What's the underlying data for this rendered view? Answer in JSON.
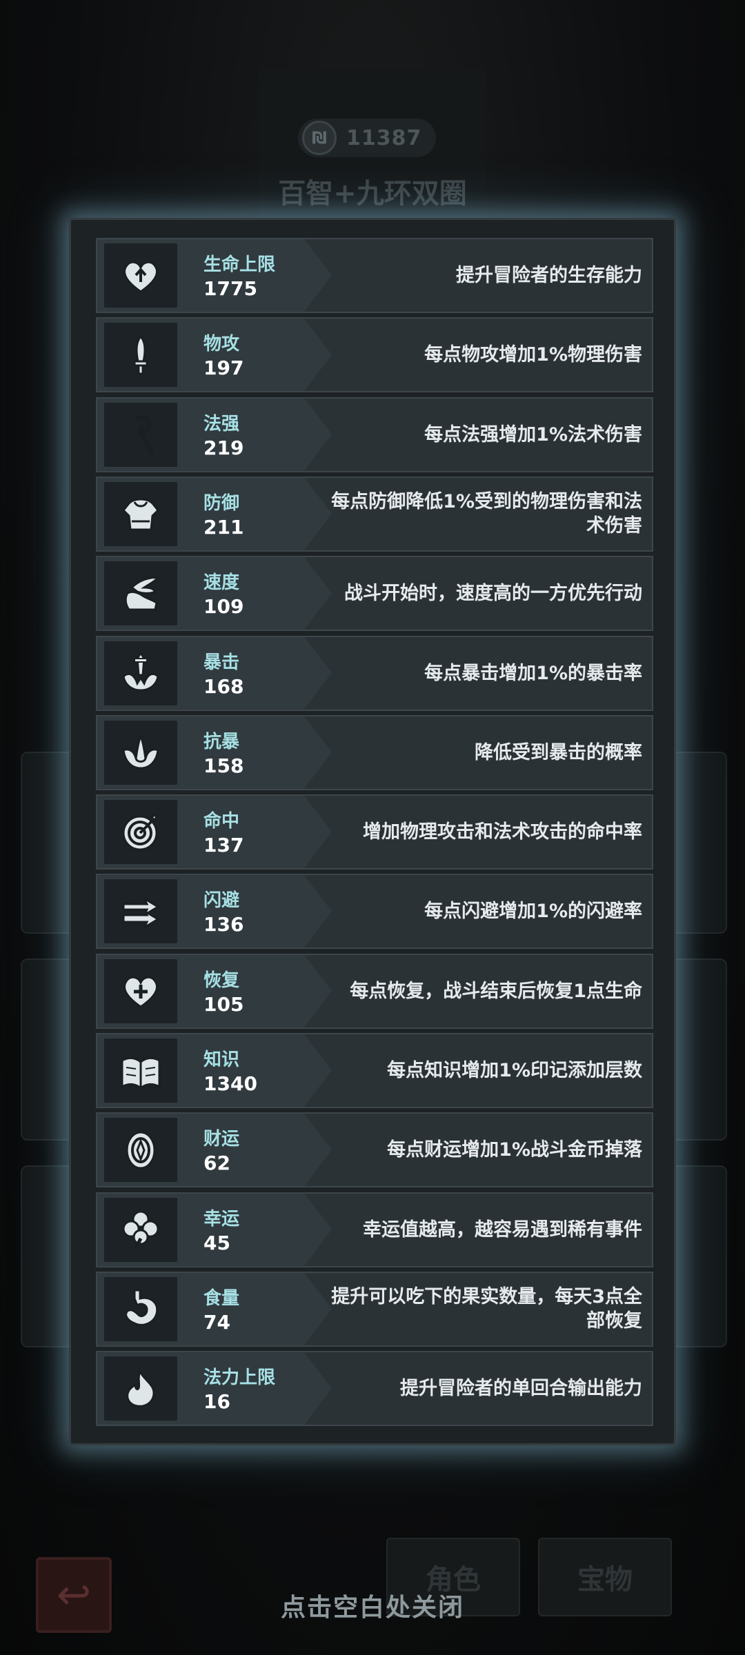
{
  "background": {
    "coin_value": "11387",
    "title": "百智+九环双圈",
    "tab_role": "角色",
    "tab_treasure": "宝物"
  },
  "close_hint": "点击空白处关闭",
  "stats": [
    {
      "icon": "heart-arrow-icon",
      "name": "生命上限",
      "value": "1775",
      "desc": "提升冒险者的生存能力"
    },
    {
      "icon": "sword-icon",
      "name": "物攻",
      "value": "197",
      "desc": "每点物攻增加1%物理伤害"
    },
    {
      "icon": "staff-icon",
      "name": "法强",
      "value": "219",
      "desc": "每点法强增加1%法术伤害"
    },
    {
      "icon": "armor-icon",
      "name": "防御",
      "value": "211",
      "desc": "每点防御降低1%受到的物理伤害和法术伤害"
    },
    {
      "icon": "winged-boot-icon",
      "name": "速度",
      "value": "109",
      "desc": "战斗开始时，速度高的一方优先行动"
    },
    {
      "icon": "critical-sword-icon",
      "name": "暴击",
      "value": "168",
      "desc": "每点暴击增加1%的暴击率"
    },
    {
      "icon": "shield-burst-icon",
      "name": "抗暴",
      "value": "158",
      "desc": "降低受到暴击的概率"
    },
    {
      "icon": "target-icon",
      "name": "命中",
      "value": "137",
      "desc": "增加物理攻击和法术攻击的命中率"
    },
    {
      "icon": "dodge-arrows-icon",
      "name": "闪避",
      "value": "136",
      "desc": "每点闪避增加1%的闪避率"
    },
    {
      "icon": "heart-plus-icon",
      "name": "恢复",
      "value": "105",
      "desc": "每点恢复，战斗结束后恢复1点生命"
    },
    {
      "icon": "book-icon",
      "name": "知识",
      "value": "1340",
      "desc": "每点知识增加1%印记添加层数"
    },
    {
      "icon": "coin-icon",
      "name": "财运",
      "value": "62",
      "desc": "每点财运增加1%战斗金币掉落"
    },
    {
      "icon": "clover-icon",
      "name": "幸运",
      "value": "45",
      "desc": "幸运值越高，越容易遇到稀有事件"
    },
    {
      "icon": "stomach-icon",
      "name": "食量",
      "value": "74",
      "desc": "提升可以吃下的果实数量，每天3点全部恢复"
    },
    {
      "icon": "mana-drop-icon",
      "name": "法力上限",
      "value": "16",
      "desc": "提升冒险者的单回合输出能力"
    }
  ]
}
